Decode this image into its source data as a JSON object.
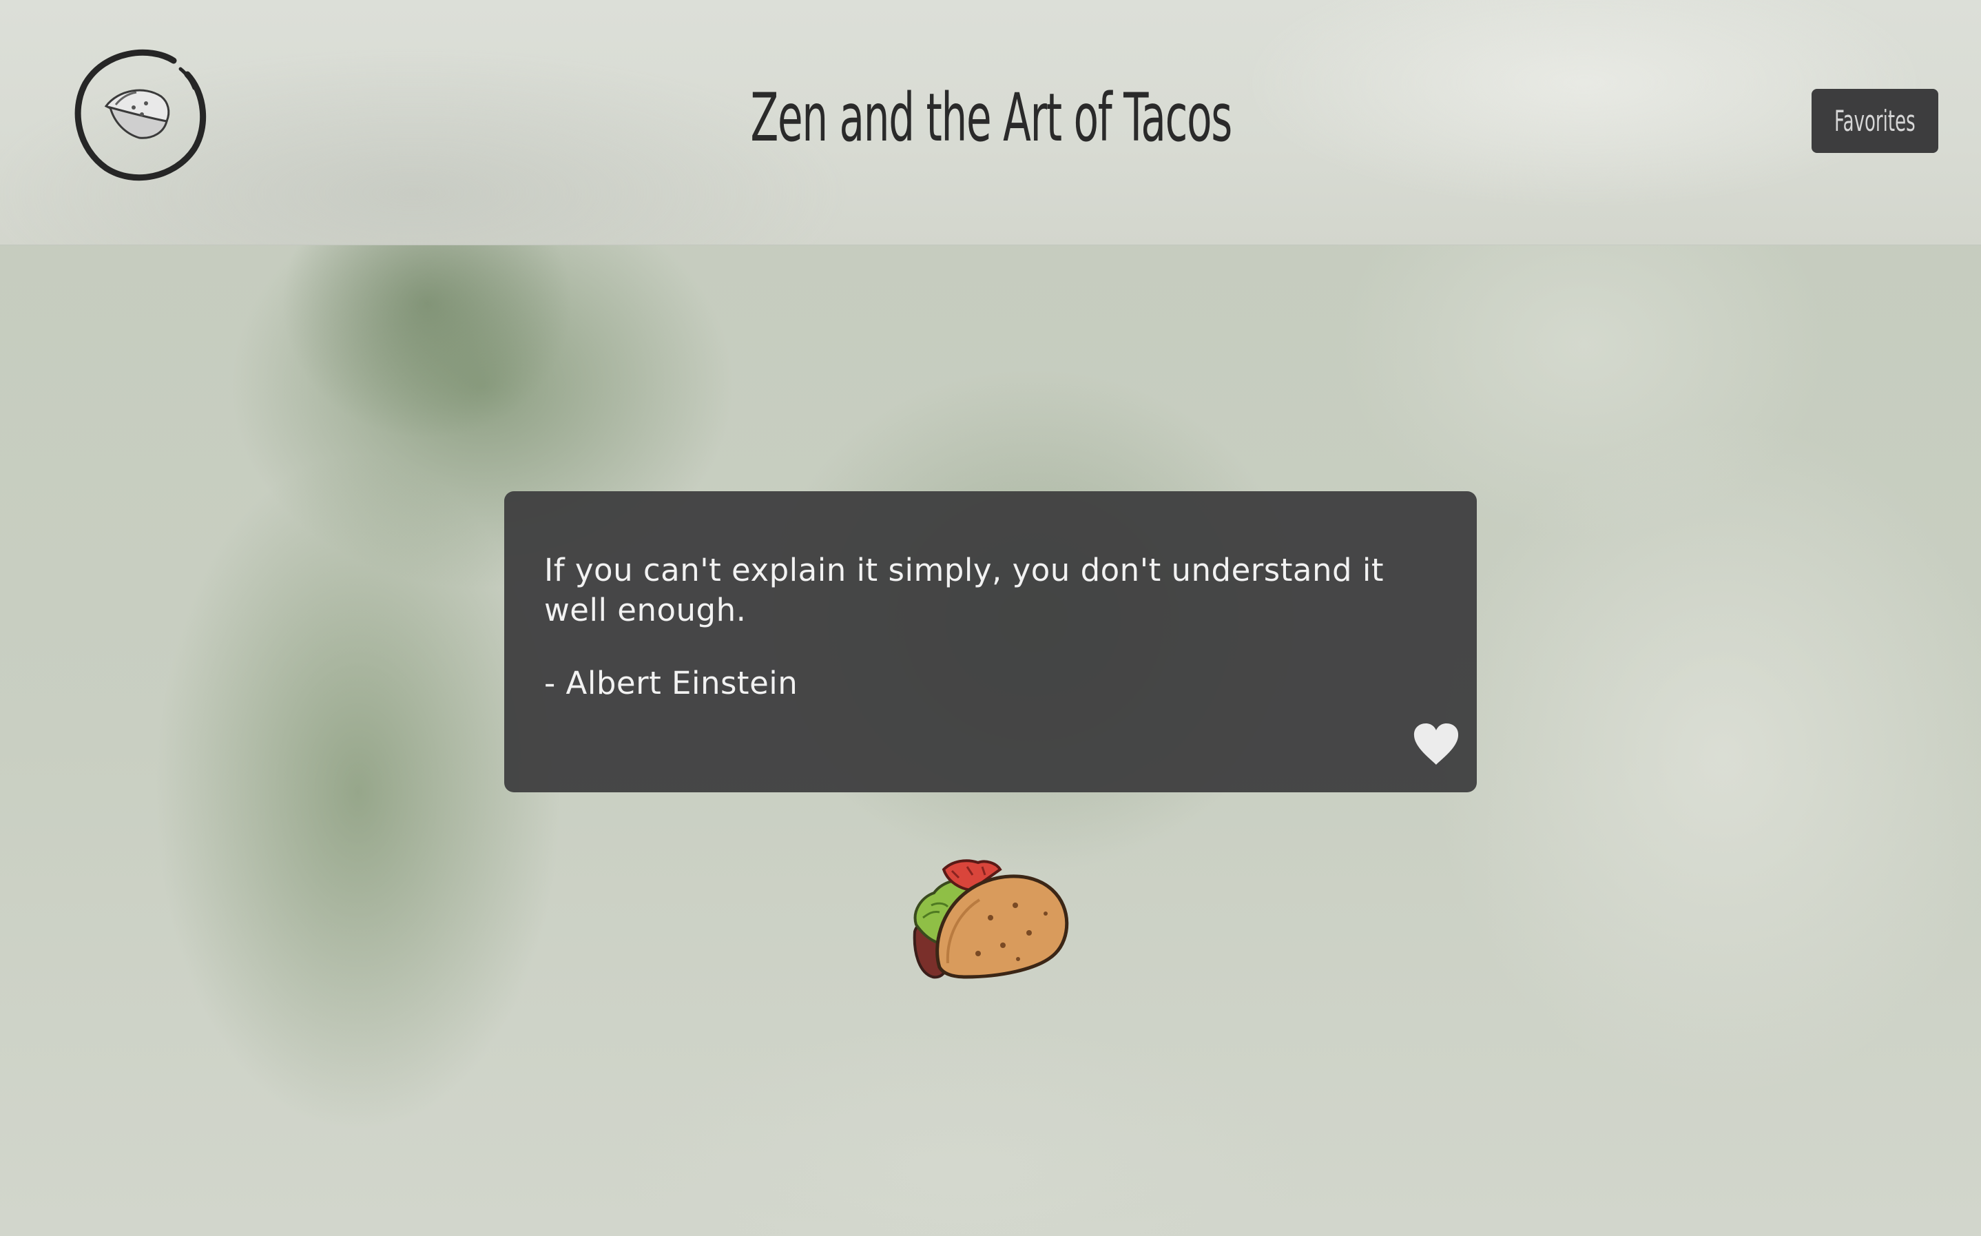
{
  "header": {
    "title": "Zen and the Art of Tacos",
    "logo_icon": "taco-logo-icon",
    "favorites_label": "Favorites"
  },
  "quote": {
    "text": "If you can't explain it simply, you don't understand it well enough.",
    "author": "- Albert Einstein",
    "favorite_icon": "heart-icon"
  },
  "illustration": {
    "icon": "taco-icon"
  },
  "colors": {
    "card_background": "#3e3e3f",
    "button_background": "#3d3d3e",
    "title_text": "#2a2a2a",
    "card_text": "#f2f2f2",
    "heart": "#ececec",
    "background_wash": "#c9cfc2"
  }
}
